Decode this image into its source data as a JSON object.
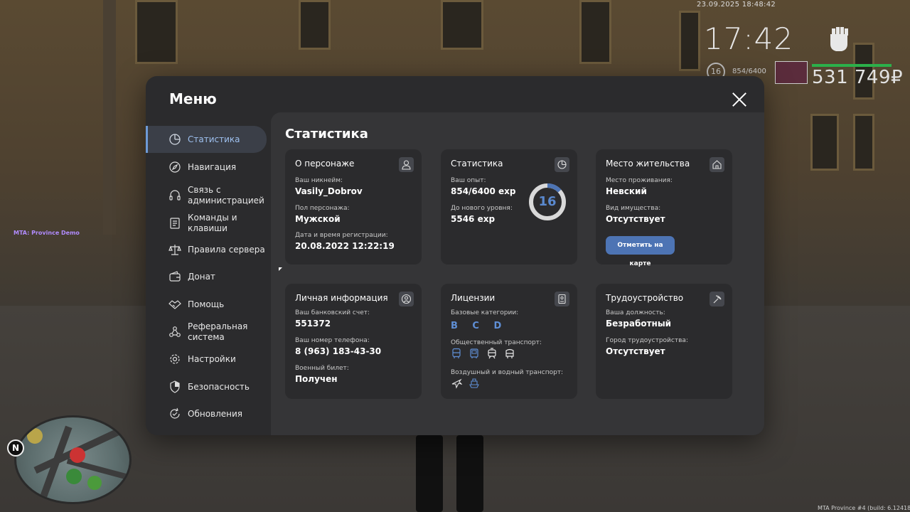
{
  "hud": {
    "datetime": "23.09.2025 18:48:42",
    "time": "17:42",
    "level": "16",
    "exp": "854/6400",
    "money": "531 749₽"
  },
  "server_tag": "MTA: Province Demo",
  "build_tag": "MTA Province #4 (build: 6.12418.9",
  "minimap": {
    "north_label": "N"
  },
  "menu": {
    "title": "Меню",
    "sidebar": [
      {
        "label": "Статистика",
        "icon": "pie-chart-icon",
        "active": true
      },
      {
        "label": "Навигация",
        "icon": "compass-icon"
      },
      {
        "label": "Связь с администрацией",
        "icon": "headset-icon"
      },
      {
        "label": "Команды и клавиши",
        "icon": "document-icon"
      },
      {
        "label": "Правила сервера",
        "icon": "scales-icon"
      },
      {
        "label": "Донат",
        "icon": "wallet-icon"
      },
      {
        "label": "Помощь",
        "icon": "handshake-icon"
      },
      {
        "label": "Реферальная система",
        "icon": "network-icon"
      },
      {
        "label": "Настройки",
        "icon": "gear-icon"
      },
      {
        "label": "Безопасность",
        "icon": "shield-icon"
      },
      {
        "label": "Обновления",
        "icon": "refresh-check-icon"
      }
    ],
    "content_title": "Статистика",
    "cards": {
      "character": {
        "title": "О персонаже",
        "icon": "user-icon",
        "nickname_label": "Ваш никнейм:",
        "nickname": "Vasily_Dobrov",
        "gender_label": "Пол персонажа:",
        "gender": "Мужской",
        "reg_label": "Дата и время регистрации:",
        "reg_date": "20.08.2022 12:22:19"
      },
      "stats": {
        "title": "Статистика",
        "icon": "pie-chart-icon",
        "exp_label": "Ваш опыт:",
        "exp": "854/6400 exp",
        "next_label": "До нового уровня:",
        "next": "5546 exp",
        "level": "16",
        "progress": 0.1334
      },
      "residence": {
        "title": "Место жительства",
        "icon": "house-icon",
        "place_label": "Место проживания:",
        "place": "Невский",
        "property_label": "Вид имущества:",
        "property": "Отсутствует",
        "button": "Отметить на карте"
      },
      "personal": {
        "title": "Личная информация",
        "icon": "user-circle-icon",
        "bank_label": "Ваш банковский счет:",
        "bank": "551372",
        "phone_label": "Ваш номер телефона:",
        "phone": "8 (963) 183-43-30",
        "military_label": "Военный билет:",
        "military": "Получен"
      },
      "licenses": {
        "title": "Лицензии",
        "icon": "id-card-icon",
        "base_label": "Базовые категории:",
        "base": "B C D",
        "public_label": "Общественный транспорт:",
        "public_icons": [
          "bus-icon",
          "minibus-icon",
          "tram-icon",
          "trolleybus-icon"
        ],
        "air_label": "Воздушный и водный транспорт:",
        "air_icons": [
          "plane-icon",
          "ship-icon"
        ]
      },
      "employment": {
        "title": "Трудоустройство",
        "icon": "pickaxe-icon",
        "position_label": "Ваша должность:",
        "position": "Безработный",
        "city_label": "Город трудоустройства:",
        "city": "Отсутствует"
      }
    }
  },
  "colors": {
    "accent": "#5f8fd6",
    "button": "#4d74b4",
    "menu_bg": "#2b2b2d",
    "content_bg": "#353537",
    "money_bar": "#2bb04a"
  }
}
